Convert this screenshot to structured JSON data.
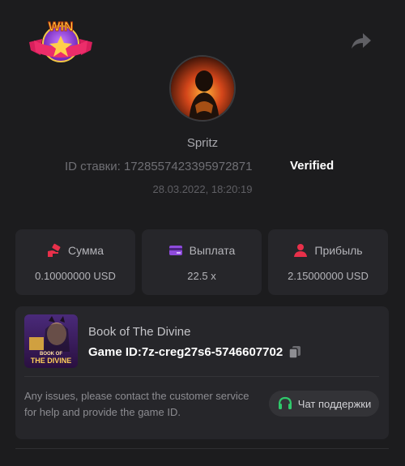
{
  "header": {
    "logo_icon": "win-badge-icon",
    "logo_text": "WIN",
    "share_icon": "share-arrow-icon"
  },
  "player": {
    "avatar_icon": "player-avatar",
    "name": "Spritz",
    "bet_id_label": "ID ставки: 1728557423395972871",
    "verified": "Verified",
    "timestamp": "28.03.2022, 18:20:19"
  },
  "stats": [
    {
      "label": "Сумма",
      "value": "0.10000000 USD",
      "icon": "money-hand-icon"
    },
    {
      "label": "Выплата",
      "value": "22.5 x",
      "icon": "card-icon"
    },
    {
      "label": "Прибыль",
      "value": "2.15000000 USD",
      "icon": "profit-user-icon"
    }
  ],
  "game": {
    "thumb_icon": "book-of-the-divine-thumbnail",
    "thumb_text_line1": "BOOK OF",
    "thumb_text_line2": "THE DIVINE",
    "title": "Book of The Divine",
    "game_id": "Game ID:7z-creg27s6-5746607702",
    "copy_icon": "copy-icon",
    "notice": "Any issues, please contact the customer service for help and provide the game ID.",
    "support_label": "Чат поддержки",
    "support_icon": "headset-icon"
  },
  "colors": {
    "background": "#1c1c1e",
    "card": "#26262a",
    "accent_red": "#e8304a",
    "accent_purple": "#8e4bdc",
    "support_green": "#2fc96b"
  }
}
